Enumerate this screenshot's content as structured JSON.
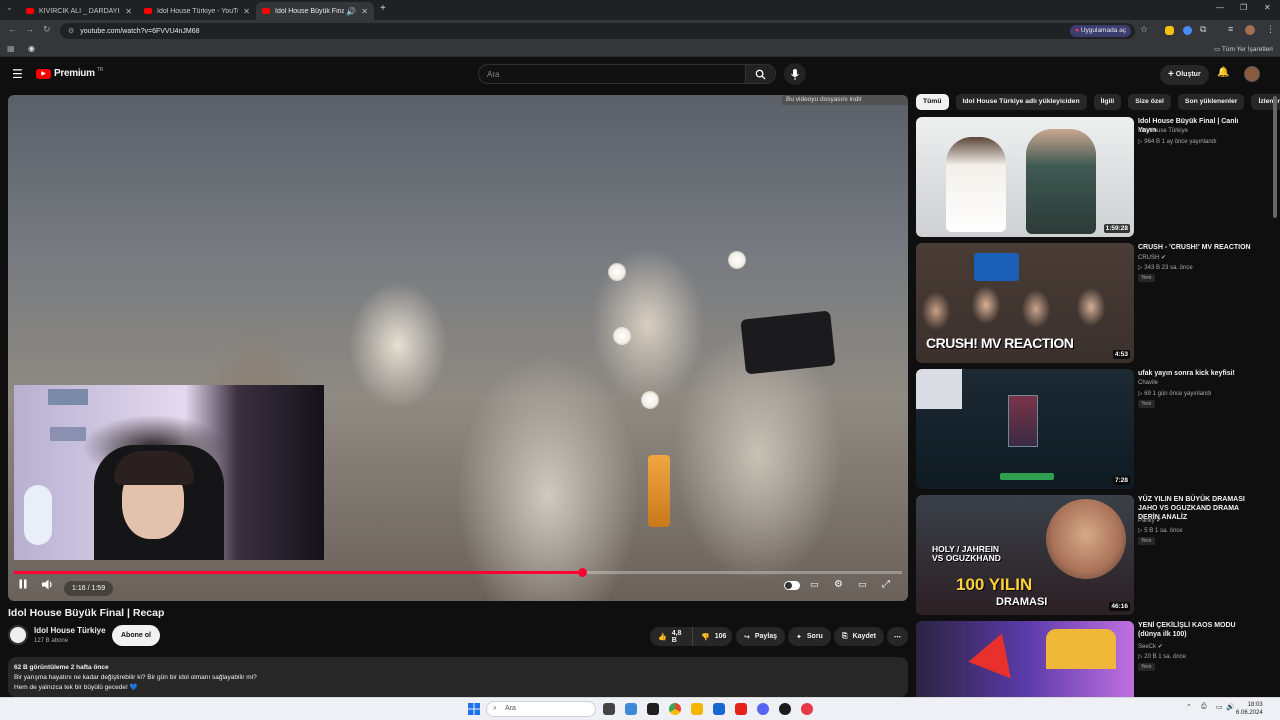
{
  "browser": {
    "tabs": [
      {
        "label": "KIVIRCIK ALİ _ DARDAYIM & Şİ",
        "active": false
      },
      {
        "label": "Idol House Türkiye - YouTube",
        "active": false
      },
      {
        "label": "Idol House Büyük Final | Re",
        "active": true
      }
    ],
    "url": "youtube.com/watch?v=6FVVU4nJM68",
    "open_in_app": "Uygulamada aç",
    "all_bookmarks": "Tüm Yer İşaretleri"
  },
  "youtube": {
    "logo": "Premium",
    "logo_region": "TR",
    "search_placeholder": "Ara",
    "create_label": "Oluştur"
  },
  "player": {
    "download_prompt": "Bu videoyu dosyasını indir",
    "current_time": "1:16",
    "duration": "1:59",
    "progress_fraction": 0.64,
    "time_display": "1:16 / 1:59"
  },
  "video": {
    "title": "Idol House Büyük Final | Recap",
    "channel": "Idol House Türkiye",
    "subscribers": "127 B abone",
    "subscribe_label": "Abone ol",
    "likes": "4,8 B",
    "dislikes": "106",
    "share_label": "Paylaş",
    "ask_label": "Soru",
    "save_label": "Kaydet",
    "views_date": "62 B görüntüleme  2 hafta önce",
    "description_lines": [
      "Bir yarışma hayatını ne kadar değiştirebilir ki? Bir gün bir idol olmanı sağlayabilir mi?",
      "Hem de yalnızca tek bir büyülü gecede! 💙"
    ]
  },
  "chips": [
    "Tümü",
    "Idol House Türkiye adlı yükleyiciden",
    "İlgili",
    "Size özel",
    "Son yüklenenler",
    "İzlenenler"
  ],
  "recommendations": [
    {
      "title": "Idol House Büyük Final | Canlı Yayın",
      "channel": "Idol House Türkiye",
      "meta": "▷ 964 B  1 ay önce yayınlandı",
      "duration": "1:59:28",
      "new": "",
      "verified": false
    },
    {
      "title": "CRUSH - 'CRUSH!' MV REACTION",
      "channel": "CRUSH",
      "meta": "▷ 343 B  23 sa. önce",
      "duration": "4:53",
      "new": "Yeni",
      "verified": true,
      "thumb_text": "CRUSH! MV REACTION"
    },
    {
      "title": "ufak yayın sonra kick keyfisi!",
      "channel": "Chavile",
      "meta": "▷ 69  1 gün önce yayınlandı",
      "duration": "7:28",
      "new": "Yeni",
      "verified": false
    },
    {
      "title": "YÜZ YILIN EN BÜYÜK DRAMASI JAHO VS OGUZKAND DRAMA DERİN ANALİZ",
      "channel": "Panky",
      "meta": "▷ 5 B  1 sa. önce",
      "duration": "46:16",
      "new": "Yeni",
      "verified": true,
      "thumb_text_1": "HOLY / JAHREIN VS OGUZKHAND",
      "thumb_text_2": "100 YILIN",
      "thumb_text_3": "DRAMASI"
    },
    {
      "title": "YENİ ÇEKİLİŞLİ KAOS MODU (dünya ilk 100)",
      "channel": "SeeCk",
      "meta": "▷ 20 B  1 sa. önce",
      "duration": "",
      "new": "Yeni",
      "verified": true
    }
  ],
  "taskbar": {
    "search_placeholder": "Ara",
    "time": "18:03",
    "date": "6.06.2024"
  },
  "colors": {
    "accent": "#ff0033",
    "background": "#0f0f0f",
    "surface": "#272727"
  }
}
